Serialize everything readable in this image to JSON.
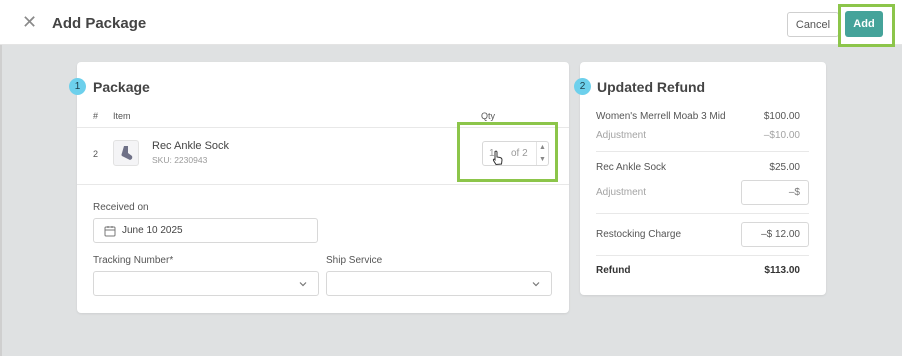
{
  "header": {
    "close_icon": "close-icon",
    "title": "Add Package",
    "cancel_label": "Cancel",
    "add_label": "Add"
  },
  "colors": {
    "accent": "#45a39a",
    "step_badge": "#6dd0ec",
    "highlight": "#8cc54a",
    "background": "#dfe1e2"
  },
  "package": {
    "step": "1",
    "title": "Package",
    "columns": {
      "num": "#",
      "item": "Item",
      "qty": "Qty"
    },
    "item": {
      "num": "2",
      "name": "Rec Ankle Sock",
      "sku": "SKU: 2230943",
      "qty_value": "1",
      "qty_of": "of 2"
    },
    "received_label": "Received on",
    "received_value": "June 10 2025",
    "tracking_label": "Tracking Number*",
    "ship_label": "Ship Service"
  },
  "refund": {
    "step": "2",
    "title": "Updated Refund",
    "line1_label": "Women's Merrell Moab 3 Mid",
    "line1_value": "$100.00",
    "adj1_label": "Adjustment",
    "adj1_value": "–$10.00",
    "line2_label": "Rec Ankle Sock",
    "line2_value": "$25.00",
    "adj2_label": "Adjustment",
    "adj2_placeholder": "–$",
    "restock_label": "Restocking Charge",
    "restock_value": "–$ 12.00",
    "total_label": "Refund",
    "total_value": "$113.00"
  }
}
